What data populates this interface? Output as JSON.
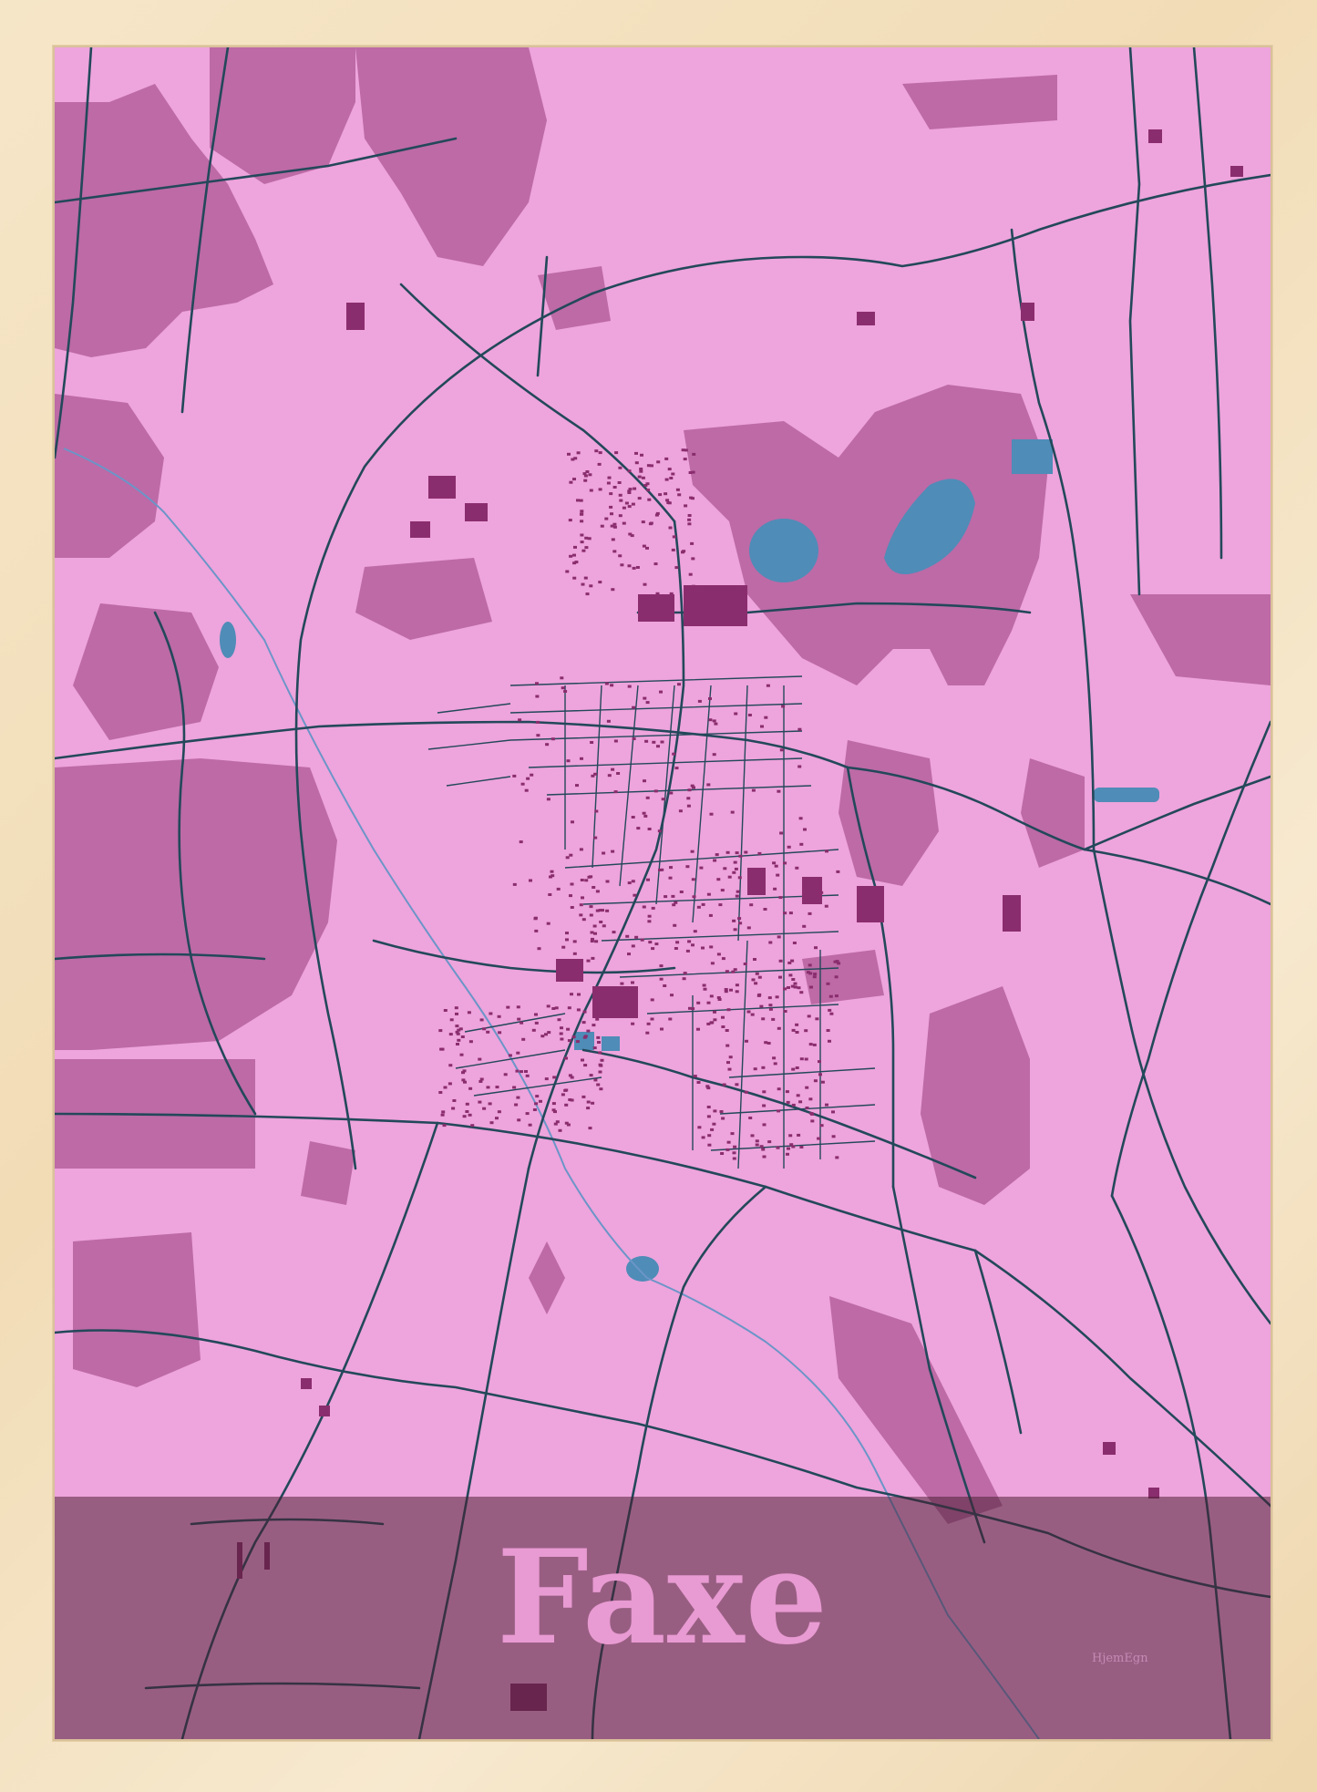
{
  "poster": {
    "title": "Faxe",
    "brand": "HjemEgn"
  },
  "colors": {
    "frame": "#f3e2c2",
    "land": "#eea4dc",
    "fields_dark": "#bd6aa6",
    "buildings": "#8a2d6e",
    "roads": "#23485a",
    "water": "#4f8cb8",
    "band_overlay": "#5a2840",
    "title_text": "#e89ad2"
  }
}
